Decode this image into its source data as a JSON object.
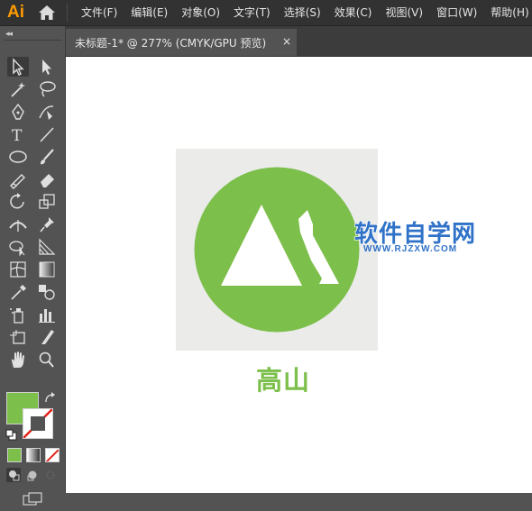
{
  "app": {
    "logo_text": "Ai"
  },
  "menu": {
    "items": [
      {
        "label": "文件(F)"
      },
      {
        "label": "编辑(E)"
      },
      {
        "label": "对象(O)"
      },
      {
        "label": "文字(T)"
      },
      {
        "label": "选择(S)"
      },
      {
        "label": "效果(C)"
      },
      {
        "label": "视图(V)"
      },
      {
        "label": "窗口(W)"
      },
      {
        "label": "帮助(H)"
      }
    ]
  },
  "toolbar": {
    "collapse_glyph": "◂◂",
    "fill_color": "#7cbf4b",
    "stroke": "none"
  },
  "document": {
    "tab_label": "未标题-1* @ 277% (CMYK/GPU 预览)",
    "close_glyph": "×"
  },
  "artwork": {
    "circle_color": "#7cbf4b",
    "background_color": "#ebebea",
    "caption": "高山"
  },
  "watermark": {
    "title": "软件自学网",
    "url": "WWW.RJZXW.COM"
  }
}
